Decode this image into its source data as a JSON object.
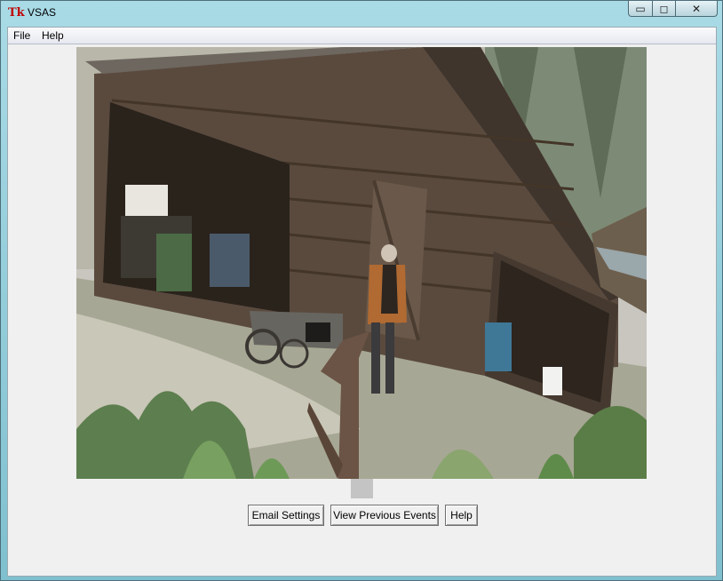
{
  "window": {
    "title": "VSAS",
    "app_icon": "Tk",
    "controls": {
      "minimize": "▭",
      "maximize": "◻",
      "close": "✕"
    }
  },
  "menu": {
    "file": "File",
    "help": "Help"
  },
  "camera": {
    "description_icon": "camera-feed-image"
  },
  "buttons": {
    "email_settings": "Email Settings",
    "view_previous_events": "View Previous Events",
    "help": "Help"
  }
}
